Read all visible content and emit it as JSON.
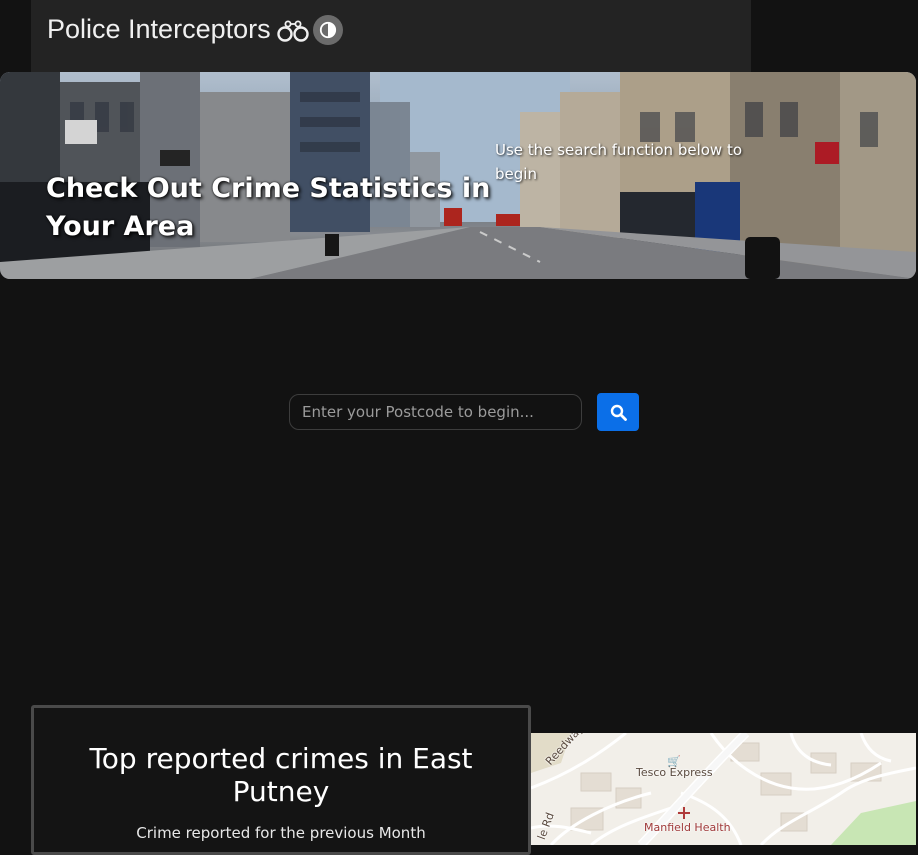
{
  "header": {
    "brand_title": "Police Interceptors"
  },
  "hero": {
    "heading": "Check Out Crime Statistics in Your Area",
    "subtext": "Use the search function below to begin"
  },
  "search": {
    "placeholder": "Enter your Postcode to begin...",
    "button_icon": "search-icon"
  },
  "crime_panel": {
    "title": "Top reported crimes in East Putney",
    "subtitle": "Crime reported for the previous Month"
  },
  "map": {
    "labels": {
      "street_1": "Reedway",
      "street_2": "le Rd",
      "shop": "Tesco Express",
      "health": "Manfield Health"
    }
  },
  "colors": {
    "background": "#121212",
    "header_bg": "#232323",
    "accent": "#0b6fe8"
  }
}
